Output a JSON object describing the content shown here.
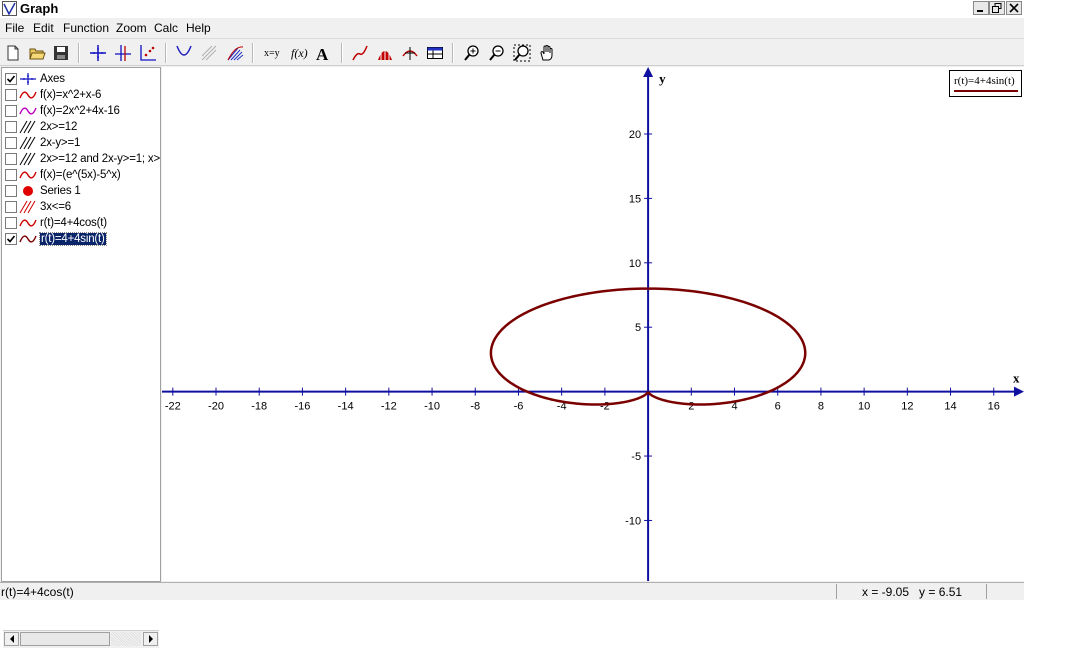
{
  "window": {
    "title": "Graph"
  },
  "menu": [
    "File",
    "Edit",
    "Function",
    "Zoom",
    "Calc",
    "Help"
  ],
  "functions": [
    {
      "label": "Axes",
      "checked": true,
      "icon": "axes-icon"
    },
    {
      "label": "f(x)=x^2+x-6",
      "checked": false,
      "icon": "red-curve-icon"
    },
    {
      "label": "f(x)=2x^2+4x-16",
      "checked": false,
      "icon": "magenta-curve-icon"
    },
    {
      "label": "2x>=12",
      "checked": false,
      "icon": "black-hatch-icon"
    },
    {
      "label": "2x-y>=1",
      "checked": false,
      "icon": "black-hatch-icon"
    },
    {
      "label": "2x>=12 and 2x-y>=1; x>=",
      "checked": false,
      "icon": "black-hatch-icon"
    },
    {
      "label": "f(x)=(e^(5x)-5^x)",
      "checked": false,
      "icon": "red-curve-icon"
    },
    {
      "label": "Series 1",
      "checked": false,
      "icon": "red-dot-icon"
    },
    {
      "label": "3x<=6",
      "checked": false,
      "icon": "red-hatch-icon"
    },
    {
      "label": "r(t)=4+4cos(t)",
      "checked": false,
      "icon": "red-curve-icon"
    },
    {
      "label": "r(t)=4+4sin(t)",
      "checked": true,
      "icon": "dark-red-curve-icon",
      "selected": true
    }
  ],
  "legend": {
    "text": "r(t)=4+4sin(t)",
    "color": "#7a0000"
  },
  "axes": {
    "x_label": "x",
    "y_label": "y",
    "x_ticks": [
      -22,
      -20,
      -18,
      -16,
      -14,
      -12,
      -10,
      -8,
      -6,
      -4,
      -2,
      2,
      4,
      6,
      8,
      10,
      12,
      14,
      16
    ],
    "y_ticks": [
      20,
      15,
      10,
      5,
      -5,
      -10
    ],
    "x_range": [
      -22.5,
      17.4
    ],
    "y_range": [
      -14.7,
      25.2
    ],
    "color": "#1010a0"
  },
  "plot": {
    "curve": {
      "equation": "r(t)=4+4sin(t)",
      "type": "polar",
      "color": "#7a0000"
    }
  },
  "status": {
    "text": "r(t)=4+4cos(t)",
    "x": "x = -9.05",
    "y": "y = 6.51"
  },
  "colors": {
    "window_bg": "#f0f0f0",
    "axis": "#1010a0",
    "curve": "#7a0000"
  }
}
